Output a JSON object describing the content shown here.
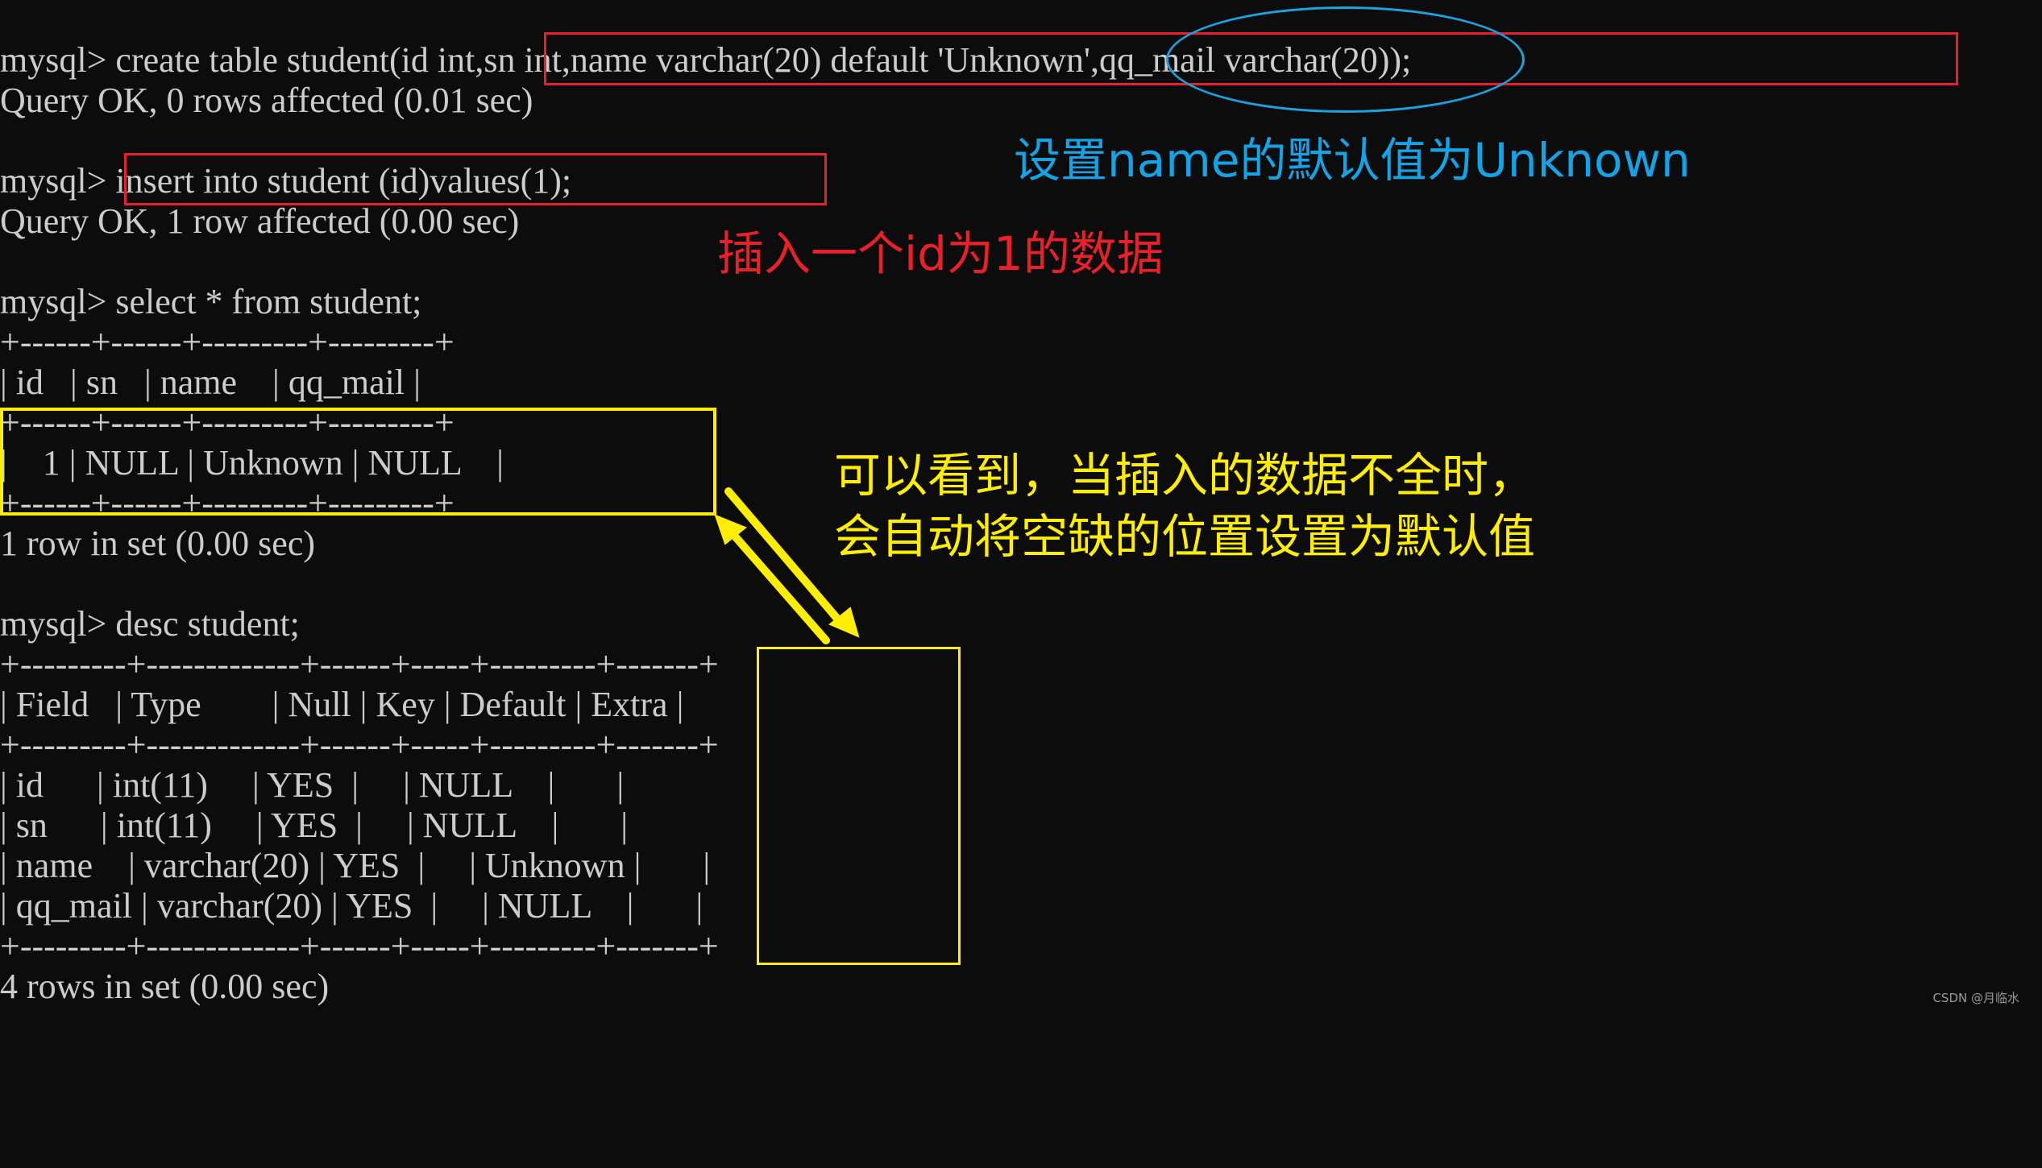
{
  "terminal": {
    "lines": [
      {
        "prompt": "mysql> ",
        "text": "create table student(id int,sn int,name varchar(20) default 'Unknown',qq_mail varchar(20));"
      },
      {
        "text": "Query OK, 0 rows affected (0.01 sec)"
      },
      {
        "prompt": "mysql> ",
        "text": "insert into student (id)values(1);"
      },
      {
        "text": "Query OK, 1 row affected (0.00 sec)"
      },
      {
        "prompt": "mysql> ",
        "text": "select * from student;"
      }
    ],
    "select_table": {
      "border_top": "+------+------+---------+---------+",
      "headers": [
        "id",
        "sn",
        "name",
        "qq_mail"
      ],
      "header_line": "| id   | sn   | name    | qq_mail |",
      "separator": "+------+------+---------+---------+",
      "rows": [
        {
          "id": "1",
          "sn": "NULL",
          "name": "Unknown",
          "qq_mail": "NULL"
        }
      ],
      "row_lines": [
        "|    1 | NULL | Unknown | NULL    |"
      ],
      "border_bottom": "+------+------+---------+---------+",
      "footer": "1 row in set (0.00 sec)"
    },
    "desc_command": {
      "prompt": "mysql> ",
      "text": "desc student;"
    },
    "desc_table": {
      "border_top": "+---------+-------------+------+-----+---------+-------+",
      "headers": [
        "Field",
        "Type",
        "Null",
        "Key",
        "Default",
        "Extra"
      ],
      "header_line": "| Field   | Type        | Null | Key | Default | Extra |",
      "separator": "+---------+-------------+------+-----+---------+-------+",
      "rows": [
        {
          "Field": "id",
          "Type": "int(11)",
          "Null": "YES",
          "Key": "",
          "Default": "NULL",
          "Extra": ""
        },
        {
          "Field": "sn",
          "Type": "int(11)",
          "Null": "YES",
          "Key": "",
          "Default": "NULL",
          "Extra": ""
        },
        {
          "Field": "name",
          "Type": "varchar(20)",
          "Null": "YES",
          "Key": "",
          "Default": "Unknown",
          "Extra": ""
        },
        {
          "Field": "qq_mail",
          "Type": "varchar(20)",
          "Null": "YES",
          "Key": "",
          "Default": "NULL",
          "Extra": ""
        }
      ],
      "row_lines": [
        "| id      | int(11)     | YES  |     | NULL    |       |",
        "| sn      | int(11)     | YES  |     | NULL    |       |",
        "| name    | varchar(20) | YES  |     | Unknown |       |",
        "| qq_mail | varchar(20) | YES  |     | NULL    |       |"
      ],
      "border_bottom": "+---------+-------------+------+-----+---------+-------+",
      "footer": "4 rows in set (0.00 sec)"
    }
  },
  "annotations": {
    "blue_note": "设置name的默认值为Unknown",
    "red_note": "插入一个id为1的数据",
    "yellow_note_line1": "可以看到，当插入的数据不全时，",
    "yellow_note_line2": "会自动将空缺的位置设置为默认值",
    "colors": {
      "red": "#e8202a",
      "blue": "#12a4e6",
      "yellow": "#ffee00",
      "text": "#cccccc",
      "background": "#0c0c0c"
    }
  },
  "watermark": "CSDN @月临水"
}
